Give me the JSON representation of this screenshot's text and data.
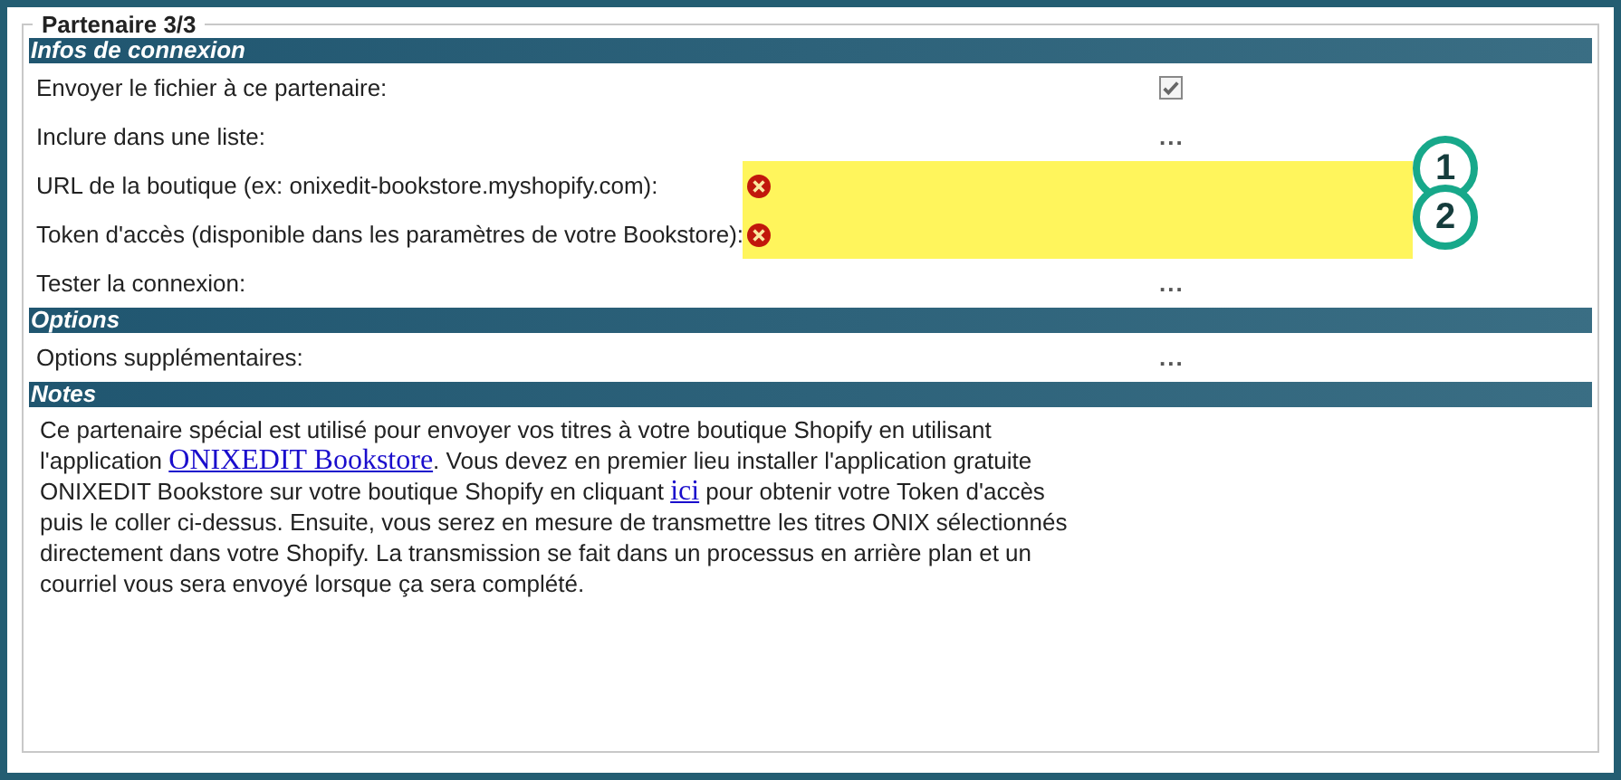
{
  "fieldset": {
    "legend": "Partenaire 3/3"
  },
  "sections": [
    {
      "title": "Infos de connexion",
      "rows": [
        {
          "label": "Envoyer le fichier à ce partenaire:",
          "kind": "checkbox",
          "checked": true
        },
        {
          "label": "Inclure dans une liste:",
          "kind": "ellipsis",
          "value": "..."
        },
        {
          "label": "URL de la boutique (ex: onixedit-bookstore.myshopify.com):",
          "kind": "error",
          "callout": "1"
        },
        {
          "label": "Token d'accès (disponible dans les paramètres de votre Bookstore):",
          "kind": "error",
          "callout": "2"
        },
        {
          "label": "Tester la connexion:",
          "kind": "ellipsis",
          "value": "..."
        }
      ]
    },
    {
      "title": "Options",
      "rows": [
        {
          "label": "Options supplémentaires:",
          "kind": "ellipsis",
          "value": "..."
        }
      ]
    },
    {
      "title": "Notes",
      "notes": [
        {
          "kind": "text",
          "text": "Ce partenaire spécial est utilisé pour envoyer vos titres à votre boutique Shopify en utilisant l'application "
        },
        {
          "kind": "link",
          "text": "ONIXEDIT Bookstore"
        },
        {
          "kind": "text",
          "text": ". Vous devez en premier lieu installer l'application gratuite ONIXEDIT Bookstore sur votre boutique Shopify en cliquant "
        },
        {
          "kind": "link",
          "text": "ici"
        },
        {
          "kind": "text",
          "text": " pour obtenir votre Token d'accès puis le coller ci-dessus. Ensuite, vous serez en mesure de transmettre les titres ONIX sélectionnés directement dans votre Shopify. La transmission se fait dans un processus en arrière plan et un courriel vous sera envoyé lorsque ça sera complété."
        }
      ]
    }
  ]
}
